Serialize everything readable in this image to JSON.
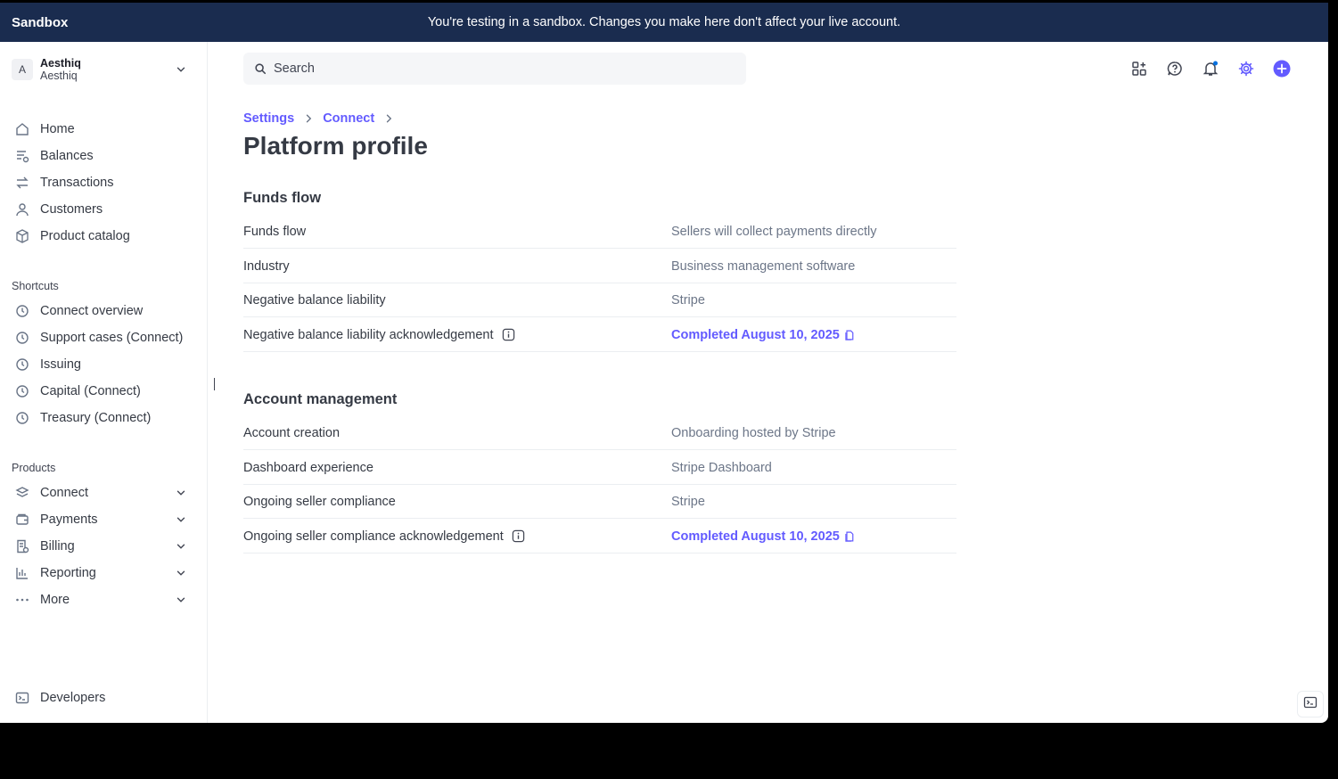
{
  "banner": {
    "env_label": "Sandbox",
    "message": "You're testing in a sandbox. Changes you make here don't affect your live account."
  },
  "account": {
    "avatar_letter": "A",
    "name": "Aesthiq",
    "subname": "Aesthiq"
  },
  "nav": {
    "main": [
      {
        "label": "Home",
        "icon": "home-icon"
      },
      {
        "label": "Balances",
        "icon": "balances-icon"
      },
      {
        "label": "Transactions",
        "icon": "transactions-icon"
      },
      {
        "label": "Customers",
        "icon": "customers-icon"
      },
      {
        "label": "Product catalog",
        "icon": "box-icon"
      }
    ],
    "shortcuts_label": "Shortcuts",
    "shortcuts": [
      {
        "label": "Connect overview",
        "icon": "clock-icon"
      },
      {
        "label": "Support cases (Connect)",
        "icon": "clock-icon"
      },
      {
        "label": "Issuing",
        "icon": "clock-icon"
      },
      {
        "label": "Capital (Connect)",
        "icon": "clock-icon"
      },
      {
        "label": "Treasury (Connect)",
        "icon": "clock-icon"
      }
    ],
    "products_label": "Products",
    "products": [
      {
        "label": "Connect",
        "icon": "layers-icon"
      },
      {
        "label": "Payments",
        "icon": "wallet-icon"
      },
      {
        "label": "Billing",
        "icon": "billing-icon"
      },
      {
        "label": "Reporting",
        "icon": "chart-icon"
      },
      {
        "label": "More",
        "icon": "more-icon"
      }
    ],
    "developers": {
      "label": "Developers",
      "icon": "terminal-icon"
    }
  },
  "search": {
    "placeholder": "Search"
  },
  "breadcrumb": [
    "Settings",
    "Connect"
  ],
  "page_title": "Platform profile",
  "sections": [
    {
      "title": "Funds flow",
      "rows": [
        {
          "key": "Funds flow",
          "value": "Sellers will collect payments directly"
        },
        {
          "key": "Industry",
          "value": "Business management software"
        },
        {
          "key": "Negative balance liability",
          "value": "Stripe"
        },
        {
          "key": "Negative balance liability acknowledgement",
          "value": "Completed August 10, 2025"
        }
      ]
    },
    {
      "title": "Account management",
      "rows": [
        {
          "key": "Account creation",
          "value": "Onboarding hosted by Stripe"
        },
        {
          "key": "Dashboard experience",
          "value": "Stripe Dashboard"
        },
        {
          "key": "Ongoing seller compliance",
          "value": "Stripe"
        },
        {
          "key": "Ongoing seller compliance acknowledgement",
          "value": "Completed August 10, 2025"
        }
      ]
    }
  ],
  "colors": {
    "accent": "#635bff",
    "banner": "#1a2c4f"
  }
}
